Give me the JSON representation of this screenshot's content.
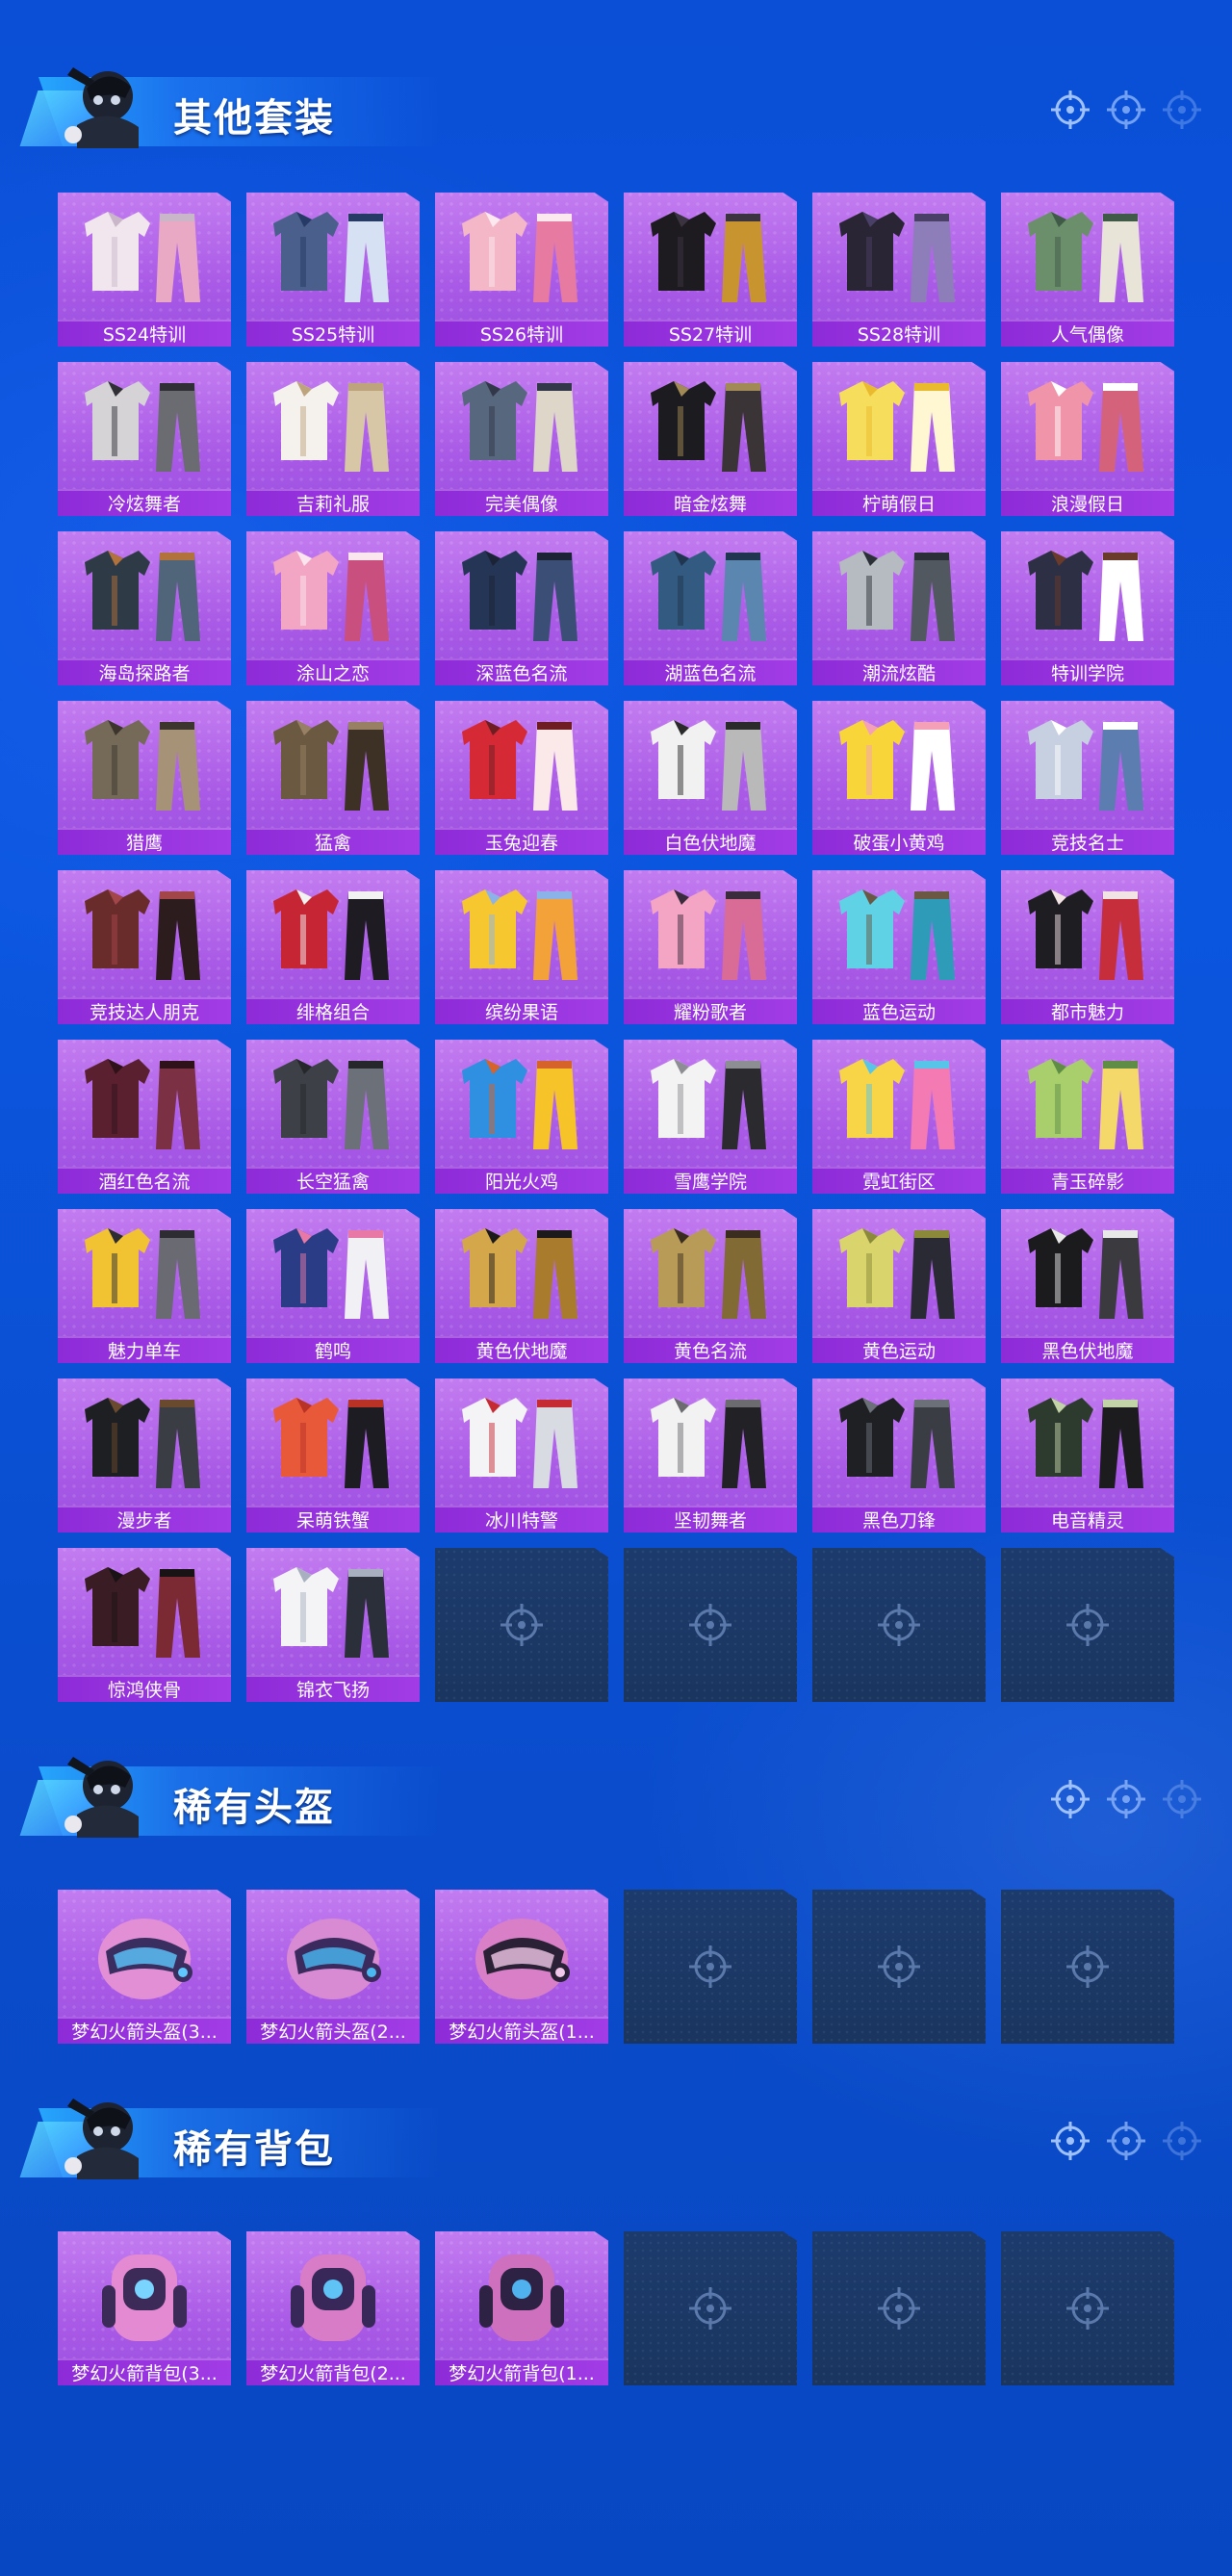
{
  "sections": [
    {
      "title": "其他套装",
      "items": [
        {
          "label": "SS24特训",
          "colors": [
            "#f2e6ee",
            "#e9a8c4",
            "#c9b7c9"
          ]
        },
        {
          "label": "SS25特训",
          "colors": [
            "#4b5f8c",
            "#d6e1f3",
            "#253a64"
          ]
        },
        {
          "label": "SS26特训",
          "colors": [
            "#f3b7c8",
            "#e67aa0",
            "#fbe9ef"
          ]
        },
        {
          "label": "SS27特训",
          "colors": [
            "#1d1a20",
            "#c89430",
            "#3b3440"
          ]
        },
        {
          "label": "SS28特训",
          "colors": [
            "#2a2535",
            "#8d7db8",
            "#4a3f66"
          ]
        },
        {
          "label": "人气偶像",
          "colors": [
            "#6b8f6a",
            "#e8e4d8",
            "#3f5a47"
          ]
        },
        {
          "label": "冷炫舞者",
          "colors": [
            "#d5d3d6",
            "#6b6b72",
            "#2f2f35"
          ]
        },
        {
          "label": "吉莉礼服",
          "colors": [
            "#f5f2ee",
            "#d8c7a7",
            "#bda47c"
          ]
        },
        {
          "label": "完美偶像",
          "colors": [
            "#57677e",
            "#ddd6c9",
            "#32384a"
          ]
        },
        {
          "label": "暗金炫舞",
          "colors": [
            "#1c1b1f",
            "#3a3437",
            "#a18a56"
          ]
        },
        {
          "label": "柠萌假日",
          "colors": [
            "#f6dd5b",
            "#fff6d2",
            "#e9b92e"
          ]
        },
        {
          "label": "浪漫假日",
          "colors": [
            "#f094a9",
            "#d4627b",
            "#ffffff"
          ]
        },
        {
          "label": "海岛探路者",
          "colors": [
            "#2f3a47",
            "#50647a",
            "#b2723c"
          ]
        },
        {
          "label": "涂山之恋",
          "colors": [
            "#f3a6c3",
            "#c94f7f",
            "#fbe6ef"
          ]
        },
        {
          "label": "深蓝色名流",
          "colors": [
            "#253556",
            "#3b4f76",
            "#1b2436"
          ]
        },
        {
          "label": "湖蓝色名流",
          "colors": [
            "#335a80",
            "#5a86b0",
            "#1f3550"
          ]
        },
        {
          "label": "潮流炫酷",
          "colors": [
            "#b6bac1",
            "#525860",
            "#2b3038"
          ]
        },
        {
          "label": "特训学院",
          "colors": [
            "#2d2f45",
            "#ffffff",
            "#6a3a2a"
          ]
        },
        {
          "label": "猎鹰",
          "colors": [
            "#756a57",
            "#a69277",
            "#3c352d"
          ]
        },
        {
          "label": "猛禽",
          "colors": [
            "#6b5a41",
            "#3c3124",
            "#978064"
          ]
        },
        {
          "label": "玉兔迎春",
          "colors": [
            "#d52a36",
            "#fbe9ea",
            "#6e1d22"
          ]
        },
        {
          "label": "白色伏地魔",
          "colors": [
            "#f1f1f1",
            "#b9b9b9",
            "#2a2a2a"
          ]
        },
        {
          "label": "破蛋小黄鸡",
          "colors": [
            "#f8d63a",
            "#ffffff",
            "#f3a0b8"
          ]
        },
        {
          "label": "竞技名士",
          "colors": [
            "#c7d0e0",
            "#5b7db0",
            "#ffffff"
          ]
        },
        {
          "label": "竞技达人朋克",
          "colors": [
            "#6a2b2b",
            "#2c1c1e",
            "#a2464a"
          ]
        },
        {
          "label": "绯格组合",
          "colors": [
            "#c62633",
            "#1e1c22",
            "#f2f2f2"
          ]
        },
        {
          "label": "缤纷果语",
          "colors": [
            "#f6c72f",
            "#f3a23a",
            "#8bb3e9"
          ]
        },
        {
          "label": "耀粉歌者",
          "colors": [
            "#f4a5c4",
            "#d96b97",
            "#3a2c3c"
          ]
        },
        {
          "label": "蓝色运动",
          "colors": [
            "#5fd2e6",
            "#2e9cb8",
            "#6a5844"
          ]
        },
        {
          "label": "都市魅力",
          "colors": [
            "#1e1d22",
            "#c52e3a",
            "#f2e3e5"
          ]
        },
        {
          "label": "酒红色名流",
          "colors": [
            "#5a2030",
            "#7c3043",
            "#2f1219"
          ]
        },
        {
          "label": "长空猛禽",
          "colors": [
            "#3d4047",
            "#6b7079",
            "#25272b"
          ]
        },
        {
          "label": "阳光火鸡",
          "colors": [
            "#2f8fe0",
            "#f6c428",
            "#d6632a"
          ]
        },
        {
          "label": "雪鹰学院",
          "colors": [
            "#f3f3f3",
            "#2b2b2f",
            "#8d8d94"
          ]
        },
        {
          "label": "霓虹街区",
          "colors": [
            "#f7d547",
            "#f37ab2",
            "#57c4e8"
          ]
        },
        {
          "label": "青玉碎影",
          "colors": [
            "#a9cf6d",
            "#f4d96a",
            "#5f8d45"
          ]
        },
        {
          "label": "魅力单车",
          "colors": [
            "#f1c232",
            "#6a6a72",
            "#2c2c32"
          ]
        },
        {
          "label": "鹤鸣",
          "colors": [
            "#2b3c86",
            "#f1f1f5",
            "#e879a6"
          ]
        },
        {
          "label": "黄色伏地魔",
          "colors": [
            "#d4a74a",
            "#a87c2c",
            "#1c1a1a"
          ]
        },
        {
          "label": "黄色名流",
          "colors": [
            "#b89b56",
            "#826a35",
            "#3a2d20"
          ]
        },
        {
          "label": "黄色运动",
          "colors": [
            "#d9d46b",
            "#2a2a34",
            "#8a8a3a"
          ]
        },
        {
          "label": "黑色伏地魔",
          "colors": [
            "#1b1b1e",
            "#3a3a3f",
            "#e8e8e8"
          ]
        },
        {
          "label": "漫步者",
          "colors": [
            "#1e1f23",
            "#3b3d44",
            "#6a4a2e"
          ]
        },
        {
          "label": "呆萌铁蟹",
          "colors": [
            "#e8593a",
            "#1d1c22",
            "#b83226"
          ]
        },
        {
          "label": "冰川特警",
          "colors": [
            "#f4f4f6",
            "#d9dbe3",
            "#c42b33"
          ]
        },
        {
          "label": "坚韧舞者",
          "colors": [
            "#f2f2f2",
            "#222226",
            "#6b6b70"
          ]
        },
        {
          "label": "黑色刀锋",
          "colors": [
            "#1f2024",
            "#3a3d44",
            "#6c7078"
          ]
        },
        {
          "label": "电音精灵",
          "colors": [
            "#2d3a2e",
            "#1c1c1f",
            "#c3d3a8"
          ]
        },
        {
          "label": "惊鸿侠骨",
          "colors": [
            "#3a1c24",
            "#7b2a33",
            "#1a1316"
          ]
        },
        {
          "label": "锦衣飞扬",
          "colors": [
            "#f4f4f6",
            "#2a2f3a",
            "#a8b0c0"
          ]
        }
      ],
      "empty_slots": 4
    },
    {
      "title": "稀有头盔",
      "items": [
        {
          "label": "梦幻火箭头盔(3...",
          "colors": [
            "#e28fd6",
            "#3a2d60",
            "#5ec8ff"
          ]
        },
        {
          "label": "梦幻火箭头盔(2...",
          "colors": [
            "#d88bd2",
            "#3b2a5e",
            "#4ab9f2"
          ]
        },
        {
          "label": "梦幻火箭头盔(1...",
          "colors": [
            "#d87fc8",
            "#2a2136",
            "#f2c8ea"
          ]
        }
      ],
      "empty_slots": 3
    },
    {
      "title": "稀有背包",
      "items": [
        {
          "label": "梦幻火箭背包(3...",
          "colors": [
            "#e48ad3",
            "#3c2a58",
            "#79d4ff"
          ]
        },
        {
          "label": "梦幻火箭背包(2...",
          "colors": [
            "#d97cc8",
            "#38285a",
            "#5fc3f5"
          ]
        },
        {
          "label": "梦幻火箭背包(1...",
          "colors": [
            "#cf70bf",
            "#2e2244",
            "#4fb2ee"
          ]
        }
      ],
      "empty_slots": 3
    }
  ],
  "icons": {
    "header_badges": [
      "target-icon",
      "target-icon",
      "target-icon"
    ],
    "empty_slot": "target-icon",
    "mascot": "mascot-avatar"
  },
  "colors": {
    "background": "#0a4fd6",
    "card_purple": "#a95ae6",
    "label_purple": "#8e2bd8",
    "empty_slot": "#1c3b6d",
    "banner_cyan": "#28aaff"
  }
}
